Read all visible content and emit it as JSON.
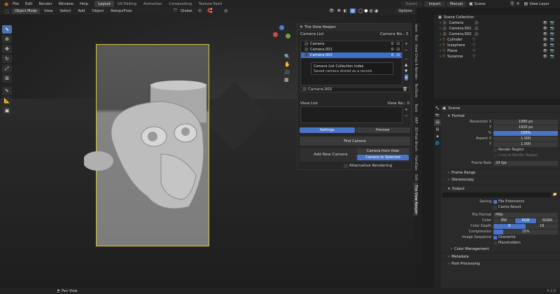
{
  "menu": {
    "items": [
      "File",
      "Edit",
      "Render",
      "Window",
      "Help"
    ]
  },
  "workspaces": {
    "tabs": [
      "Layout",
      "UV Editing",
      "Animation",
      "Compositing",
      "Texture Paint"
    ]
  },
  "topright": {
    "export": "Export",
    "import": "Import",
    "manual": "Manual",
    "scene": "Scene",
    "view_layer": "View Layer"
  },
  "header": {
    "mode": "Object Mode",
    "view": "View",
    "select": "Select",
    "add": "Add",
    "object": "Object",
    "retopo": "RetopoFlow",
    "transform": "Global",
    "options": "Options"
  },
  "npanel": {
    "title": "The View Keeper",
    "camera_list_label": "Camera List",
    "camera_no_label": "Camera No.:",
    "camera_no_value": "3",
    "cameras": [
      "Camera",
      "Camera.001",
      "Camera.002"
    ],
    "camera_idx": [
      "0",
      "0",
      "0"
    ],
    "name_field": "Camera.002",
    "view_list_label": "View List",
    "view_no_label": "View No.:",
    "view_no_value": "0",
    "tab_settings": "Settings",
    "tab_preview": "Preview",
    "find_camera": "Find Camera",
    "add_new_camera": "Add New Camera",
    "camera_from_view": "Camera from View",
    "camera_to_selected": "Camera to Selected",
    "alt_rendering": "Alternative Rendering"
  },
  "tooltip": {
    "title": "Camera List Collection Index",
    "desc": "Saved camera  stored as a record."
  },
  "sidetabs": [
    "Item",
    "Tool",
    "View",
    "Drop It Render",
    "TexTools",
    "Tools",
    "ARP",
    "3D-Hub Brush",
    "HardOps",
    "Edit",
    "The View Keeper"
  ],
  "outliner": {
    "collection": "Scene Collection",
    "items": [
      "Camera",
      "Camera.001",
      "Camera.002",
      "Cylinder",
      "Icosphere",
      "Plane",
      "Suzanne"
    ]
  },
  "props": {
    "scene_label": "Scene",
    "format_label": "Format",
    "res_x_label": "Resolution X",
    "res_x": "1080 px",
    "res_y_label": "Y",
    "res_y": "1920 px",
    "res_pct_label": "%",
    "res_pct": "100%",
    "aspect_x_label": "Aspect X",
    "aspect_x": "1.000",
    "aspect_y_label": "Y",
    "aspect_y": "1.000",
    "render_region": "Render Region",
    "crop_region": "Crop to Render Region",
    "frame_rate_label": "Frame Rate",
    "frame_rate": "24 fps",
    "frame_range": "Frame Range",
    "stereoscopy": "Stereoscopy",
    "output": "Output",
    "saving_label": "Saving",
    "file_ext": "File Extensions",
    "cache_result": "Cache Result",
    "file_format_label": "File Format",
    "file_format": "PNG",
    "color_label": "Color",
    "color_opts": [
      "BW",
      "RGB",
      "RGBA"
    ],
    "depth_label": "Color Depth",
    "depth_opts": [
      "8",
      "16"
    ],
    "compression_label": "Compression",
    "compression": "15%",
    "img_seq_label": "Image Sequence",
    "overwrite": "Overwrite",
    "placeholders": "Placeholders",
    "color_mgmt": "Color Management",
    "metadata": "Metadata",
    "post": "Post Processing"
  },
  "status": {
    "pan": "Pan View",
    "version": "4.2.0"
  },
  "colors": {
    "accent": "#4a74c8",
    "camera_border": "#d8c84a"
  }
}
